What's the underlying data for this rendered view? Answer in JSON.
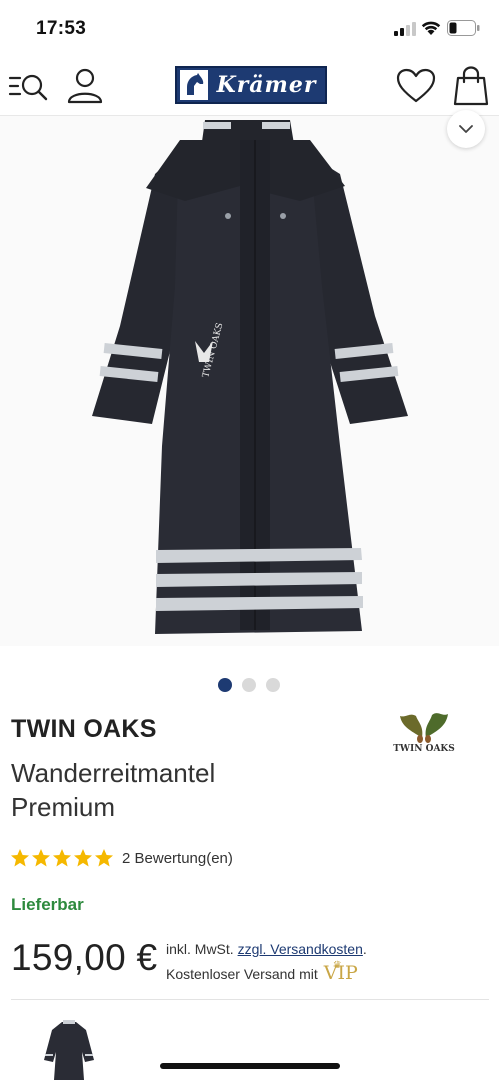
{
  "status_bar": {
    "time": "17:53"
  },
  "header": {
    "logo_text": "Krämer",
    "icons": [
      "menu-search-icon",
      "account-icon",
      "heart-icon",
      "shopping-bag-icon"
    ]
  },
  "gallery": {
    "image_count": 3,
    "active_index": 0
  },
  "product": {
    "brand": "TWIN OAKS",
    "brand_logo_text": "TWIN OAKS",
    "name": "Wanderreitmantel Premium",
    "rating_stars": 5,
    "rating_text": "2 Bewertung(en)",
    "availability": "Lieferbar",
    "price": "159,00 €",
    "tax_prefix": "inkl. MwSt. ",
    "shipping_link": "zzgl. Versandkosten",
    "tax_suffix": ".",
    "free_shipping": "Kostenloser Versand mit",
    "vip_label": "VIP"
  },
  "colors": {
    "brand_blue": "#1d3a72",
    "star_gold": "#f5b800",
    "available_green": "#2e8a3e",
    "vip_gold": "#c9a646"
  }
}
